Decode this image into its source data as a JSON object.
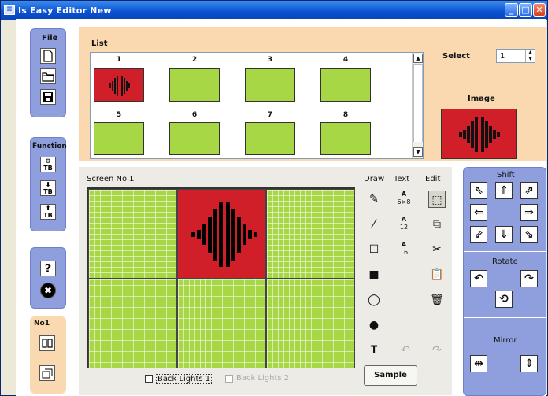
{
  "app": {
    "title": "Is Easy Editor  New"
  },
  "titlebar": {
    "icon": "app-icon",
    "minimize": "_",
    "maximize": "□",
    "close": "✕"
  },
  "left": {
    "file_label": "File",
    "function_label": "Function",
    "no_label": "No1",
    "func_text_1": "TB",
    "func_text_2": "TB",
    "func_text_3": "TB",
    "help": "?",
    "exit": "✖"
  },
  "list": {
    "label": "List",
    "numbers": [
      "1",
      "2",
      "3",
      "4",
      "5",
      "6",
      "7",
      "8"
    ],
    "select_label": "Select",
    "select_value": "1",
    "image_label": "Image"
  },
  "screen": {
    "label": "Screen No.1",
    "draw_label": "Draw",
    "text_label": "Text",
    "edit_label": "Edit",
    "text_sizes": [
      "6×8",
      "12",
      "16"
    ],
    "backlight1": "Back Lights 1",
    "backlight2": "Back Lights 2",
    "sample_button": "Sample"
  },
  "right": {
    "shift_label": "Shift",
    "rotate_label": "Rotate",
    "mirror_label": "Mirror"
  },
  "colors": {
    "lcd_green": "#a7d744",
    "lcd_red": "#d01f28",
    "panel_blue": "#8f9fde",
    "panel_orange": "#fad8b0"
  }
}
